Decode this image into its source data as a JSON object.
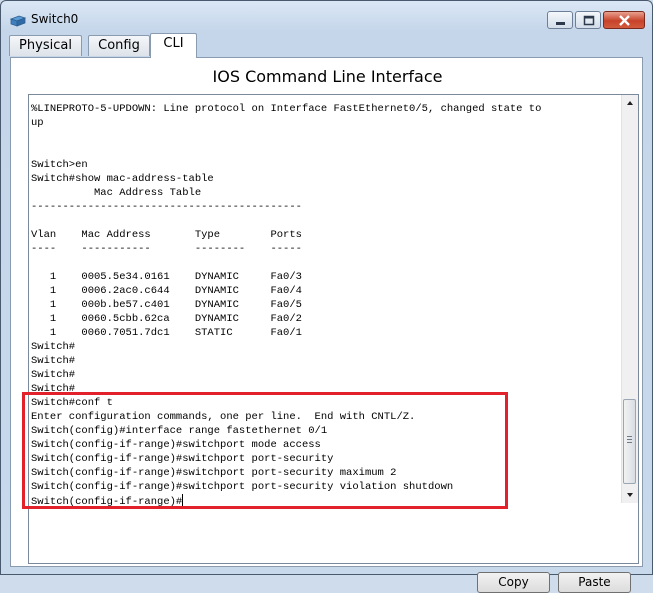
{
  "window": {
    "title": "Switch0"
  },
  "tabs": [
    {
      "label": "Physical"
    },
    {
      "label": "Config"
    },
    {
      "label": "CLI"
    }
  ],
  "cli": {
    "heading": "IOS Command Line Interface",
    "lines": [
      "%LINEPROTO-5-UPDOWN: Line protocol on Interface FastEthernet0/5, changed state to",
      "up",
      "",
      "",
      "Switch>en",
      "Switch#show mac-address-table",
      "          Mac Address Table",
      "-------------------------------------------",
      "",
      "Vlan    Mac Address       Type        Ports",
      "----    -----------       --------    -----",
      "",
      "   1    0005.5e34.0161    DYNAMIC     Fa0/3",
      "   1    0006.2ac0.c644    DYNAMIC     Fa0/4",
      "   1    000b.be57.c401    DYNAMIC     Fa0/5",
      "   1    0060.5cbb.62ca    DYNAMIC     Fa0/2",
      "   1    0060.7051.7dc1    STATIC      Fa0/1",
      "Switch#",
      "Switch#",
      "Switch#",
      "Switch#",
      "Switch#conf t",
      "Enter configuration commands, one per line.  End with CNTL/Z.",
      "Switch(config)#interface range fastethernet 0/1",
      "Switch(config-if-range)#switchport mode access",
      "Switch(config-if-range)#switchport port-security",
      "Switch(config-if-range)#switchport port-security maximum 2",
      "Switch(config-if-range)#switchport port-security violation shutdown",
      "Switch(config-if-range)#"
    ]
  },
  "buttons": {
    "copy": "Copy",
    "paste": "Paste"
  },
  "colors": {
    "highlight": "#e3212b"
  }
}
